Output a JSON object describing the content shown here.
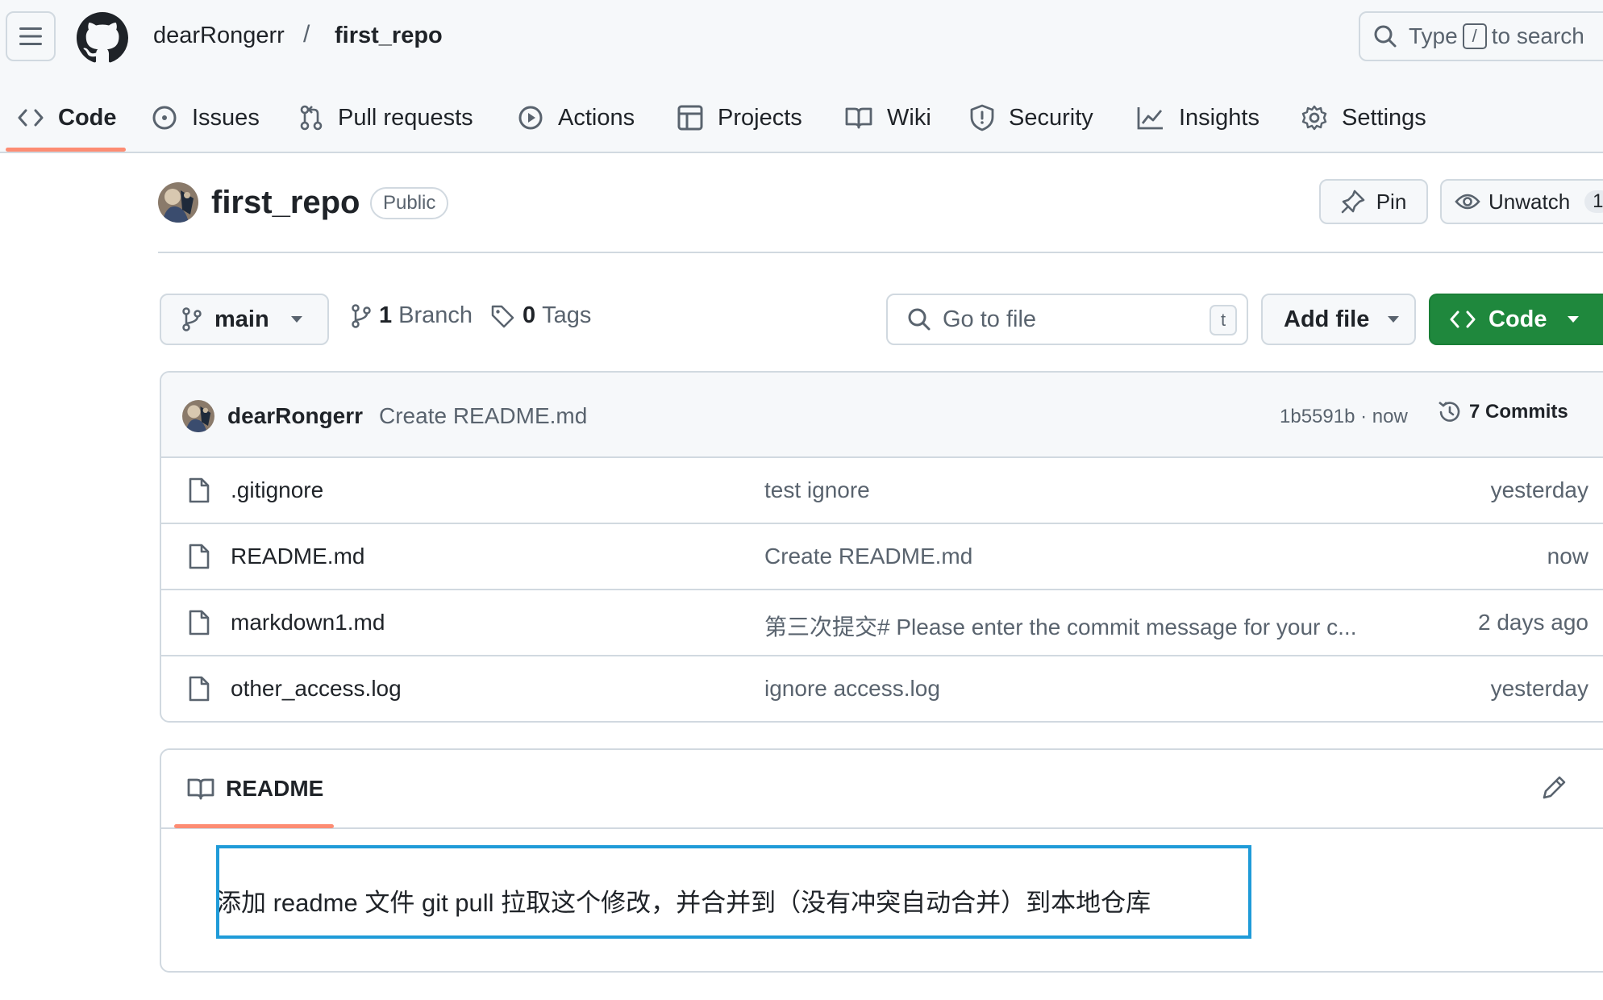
{
  "header": {
    "owner": "dearRongerr",
    "separator": "/",
    "repo": "first_repo",
    "search": {
      "prefix": "Type",
      "key": "/",
      "suffix": "to search"
    }
  },
  "tabs": [
    {
      "label": "Code",
      "icon": "code-icon",
      "active": true
    },
    {
      "label": "Issues",
      "icon": "issue-icon"
    },
    {
      "label": "Pull requests",
      "icon": "pull-request-icon"
    },
    {
      "label": "Actions",
      "icon": "play-icon"
    },
    {
      "label": "Projects",
      "icon": "table-icon"
    },
    {
      "label": "Wiki",
      "icon": "book-icon"
    },
    {
      "label": "Security",
      "icon": "shield-icon"
    },
    {
      "label": "Insights",
      "icon": "graph-icon"
    },
    {
      "label": "Settings",
      "icon": "gear-icon"
    }
  ],
  "repo_header": {
    "name": "first_repo",
    "visibility": "Public",
    "pin_label": "Pin",
    "watch_label": "Unwatch",
    "watch_count": "1"
  },
  "controls": {
    "branch": "main",
    "branches_count": "1",
    "branches_label": "Branch",
    "tags_count": "0",
    "tags_label": "Tags",
    "goto_placeholder": "Go to file",
    "goto_key": "t",
    "add_file_label": "Add file",
    "code_label": "Code"
  },
  "latest_commit": {
    "author": "dearRongerr",
    "message": "Create README.md",
    "sha_time": "1b5591b · now",
    "commits_label": "7 Commits"
  },
  "files": [
    {
      "name": ".gitignore",
      "message": "test ignore",
      "time": "yesterday"
    },
    {
      "name": "README.md",
      "message": "Create README.md",
      "time": "now"
    },
    {
      "name": "markdown1.md",
      "message": "第三次提交# Please enter the commit message for your c...",
      "time": "2 days ago"
    },
    {
      "name": "other_access.log",
      "message": "ignore access.log",
      "time": "yesterday"
    }
  ],
  "readme": {
    "tab_label": "README",
    "content": "添加 readme 文件 git pull 拉取这个修改，并合并到（没有冲突自动合并）到本地仓库"
  },
  "colors": {
    "accent_underline": "#fd8c73",
    "code_button": "#1f883d",
    "highlight_frame": "#1f9bd8",
    "border": "#d1d9e0"
  }
}
